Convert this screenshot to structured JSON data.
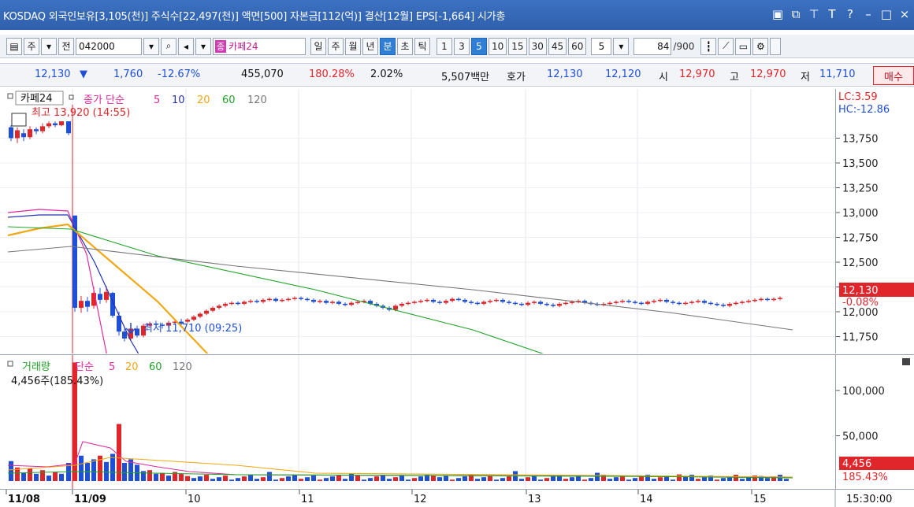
{
  "title": "KOSDAQ 외국인보유[3,105(천)] 주식수[22,497(천)] 액면[500] 자본금[112(억)] 결산[12월] EPS[-1,664] 시가총",
  "toolbar": {
    "ju": "주",
    "jeon": "전",
    "code": "042000",
    "jong_badge": "종",
    "name": "카페24",
    "periods": [
      "일",
      "주",
      "월",
      "년",
      "분",
      "초",
      "틱"
    ],
    "selected_period": "분",
    "intervals": [
      "1",
      "3",
      "5",
      "10",
      "15",
      "30",
      "45",
      "60"
    ],
    "selected_interval": "5",
    "n_value": "5",
    "count": "84",
    "count_max": "/900"
  },
  "quote": {
    "price": "12,130",
    "arrow": "▼",
    "change": "1,760",
    "change_pct": "-12.67%",
    "volume": "455,070",
    "vol_ratio": "180.28%",
    "turnover": "2.02%",
    "amount": "5,507백만",
    "hoga_label": "호가",
    "ask": "12,130",
    "bid": "12,120",
    "open_label": "시",
    "open": "12,970",
    "high_label": "고",
    "high": "12,970",
    "low_label": "저",
    "low": "11,710",
    "buy": "매수"
  },
  "price_panel": {
    "name": "카페24",
    "indicator": "종가 단순",
    "ma_labels": [
      "5",
      "10",
      "20",
      "60",
      "120"
    ],
    "max_label": "최고 13,920 (14:55)",
    "min_label": "최저 11,710 (09:25)",
    "lc": "LC:3.59",
    "hc": "HC:-12.86",
    "price_tag": "12,130",
    "pct_tag": "-0.08%",
    "ticks": [
      "13,750",
      "13,500",
      "13,250",
      "13,000",
      "12,750",
      "12,500",
      "12,250",
      "12,000",
      "11,750"
    ]
  },
  "volume_panel": {
    "title": "거래량",
    "indicator": "단순",
    "ma_labels": [
      "5",
      "20",
      "60",
      "120"
    ],
    "info": "4,456주(185.43%)",
    "ticks": [
      "100,000",
      "50,000"
    ],
    "vol_tag": "4,456",
    "pct_tag": "185.43%"
  },
  "x_labels": [
    "11/08",
    "11/09",
    "10",
    "11",
    "12",
    "13",
    "14",
    "15"
  ],
  "time_label": "15:30:00",
  "colors": {
    "up": "#e1262b",
    "down": "#1f4fd6",
    "ma5": "#e0299d",
    "ma10": "#2233b8",
    "ma20": "#f0a915",
    "ma60": "#22a22a",
    "ma120": "#777777"
  }
}
